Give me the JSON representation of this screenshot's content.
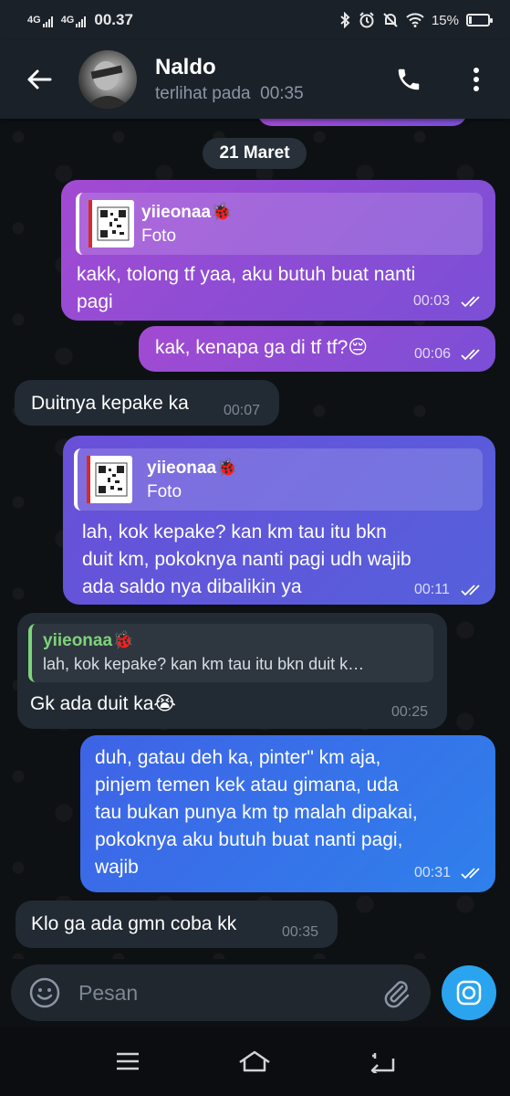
{
  "status_bar": {
    "network_1": "4G",
    "network_2": "4G",
    "time": "00.37",
    "battery": "15%",
    "battery_level": 0.15,
    "icons": [
      "bluetooth-icon",
      "alarm-icon",
      "mute-icon",
      "wifi-icon",
      "battery-icon"
    ]
  },
  "header": {
    "contact_name": "Naldo",
    "last_seen": "terlihat pada  00:35",
    "icons": [
      "back-arrow-icon",
      "phone-icon",
      "more-vert-icon"
    ]
  },
  "chat": {
    "date_chip": "21 Maret",
    "messages": [
      {
        "direction": "out",
        "reply_name": "yiieonaa🐞",
        "reply_sub": "Foto",
        "text_lines": [
          "kakk, tolong tf yaa, aku butuh buat nanti",
          "pagi"
        ],
        "time": "00:03"
      },
      {
        "direction": "out",
        "text": "kak, kenapa ga di tf tf?😔",
        "time": "00:06"
      },
      {
        "direction": "in",
        "text": "Duitnya kepake ka",
        "time": "00:07"
      },
      {
        "direction": "out",
        "reply_name": "yiieonaa🐞",
        "reply_sub": "Foto",
        "text_lines": [
          "lah, kok kepake? kan km tau itu bkn",
          "duit km, pokoknya nanti pagi udh wajib",
          "ada saldo nya dibalikin ya"
        ],
        "time": "00:11"
      },
      {
        "direction": "in",
        "reply_name": "yiieonaa🐞",
        "reply_sub": "lah, kok kepake? kan km tau itu bkn duit k…",
        "text": "Gk ada duit ka😭",
        "time": "00:25"
      },
      {
        "direction": "out",
        "text_lines": [
          "duh, gatau deh ka, pinter\" km aja,",
          "pinjem temen kek atau gimana, uda",
          "tau bukan punya km tp malah dipakai,",
          "pokoknya aku butuh buat nanti pagi,",
          "wajib"
        ],
        "time": "00:31"
      },
      {
        "direction": "in",
        "text": "Klo ga ada gmn coba kk",
        "time": "00:35"
      }
    ]
  },
  "composer": {
    "placeholder": "Pesan",
    "icons": [
      "emoji-icon",
      "attach-icon",
      "camera-icon"
    ]
  },
  "nav": {
    "icons": [
      "menu-icon",
      "home-icon",
      "back-icon"
    ]
  }
}
